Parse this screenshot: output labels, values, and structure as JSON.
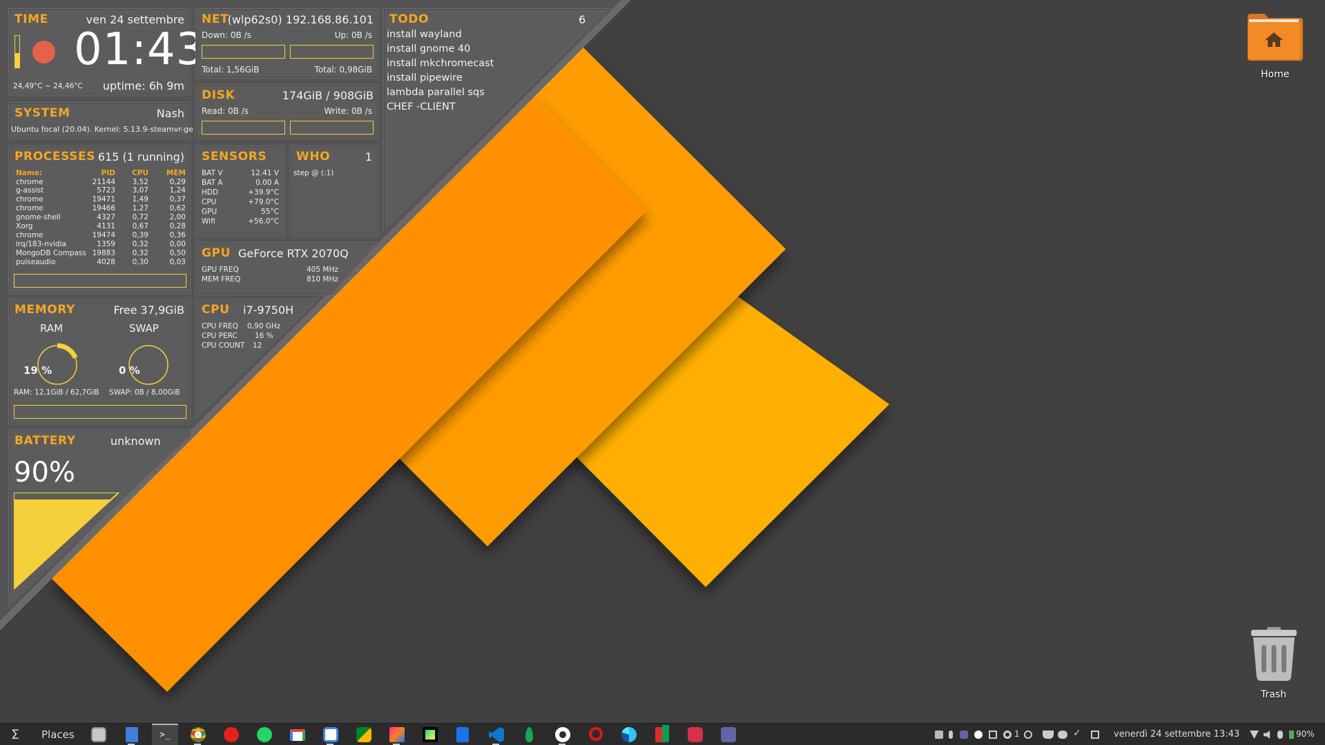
{
  "colors": {
    "accent": "#f5a623",
    "bar_border": "#f5d03a",
    "panel_bg": "#5c5c5c",
    "desktop_bg": "#414141"
  },
  "time": {
    "title": "TIME",
    "date": "ven 24 settembre",
    "clock": "01:43",
    "temp": "24,49°C ~ 24,46°C",
    "uptime": "uptime: 6h 9m"
  },
  "system": {
    "title": "SYSTEM",
    "host": "Nash",
    "info": "Ubuntu focal (20.04). Kernel: 5.13.9-steamvr-ge"
  },
  "processes": {
    "title": "PROCESSES",
    "count": "615 (1 running)",
    "columns": [
      "Name:",
      "PID",
      "CPU",
      "MEM"
    ],
    "rows": [
      [
        "chrome",
        "21144",
        "3,52",
        "0,29"
      ],
      [
        "g-assist",
        "5723",
        "3,07",
        "1,24"
      ],
      [
        "chrome",
        "19471",
        "1,49",
        "0,37"
      ],
      [
        "chrome",
        "19466",
        "1,27",
        "0,62"
      ],
      [
        "gnome-shell",
        "4327",
        "0,72",
        "2,00"
      ],
      [
        "Xorg",
        "4131",
        "0,67",
        "0,28"
      ],
      [
        "chrome",
        "19474",
        "0,39",
        "0,36"
      ],
      [
        "irq/183-nvidia",
        "1359",
        "0,32",
        "0,00"
      ],
      [
        "MongoDB Compass",
        "19883",
        "0,32",
        "0,50"
      ],
      [
        "pulseaudio",
        "4028",
        "0,30",
        "0,03"
      ]
    ]
  },
  "memory": {
    "title": "MEMORY",
    "free": "Free 37,9GiB",
    "ram_label": "RAM",
    "swap_label": "SWAP",
    "ram_pct_text": "19 %",
    "swap_pct_text": "0 %",
    "ram_fraction": 0.19,
    "swap_fraction": 0.0,
    "ram_detail": "RAM: 12,1GiB / 62,7GiB",
    "swap_detail": "SWAP: 0B   / 8,00GiB"
  },
  "battery": {
    "title": "BATTERY",
    "status": "unknown",
    "percent_text": "90%",
    "fraction": 0.9
  },
  "net": {
    "title": "NET",
    "iface": "(wlp62s0) 192.168.86.101",
    "down": "Down: 0B  /s",
    "up": "Up: 0B  /s",
    "total_down": "Total: 1,56GiB",
    "total_up": "Total: 0,98GiB"
  },
  "disk": {
    "title": "DISK",
    "usage": "174GiB / 908GiB",
    "read": "Read: 0B  /s",
    "write": "Write: 0B  /s"
  },
  "sensors": {
    "title": "SENSORS",
    "rows": [
      [
        "BAT V",
        "12.41 V"
      ],
      [
        "BAT A",
        "0.00 A"
      ],
      [
        "HDD",
        "+39.9°C"
      ],
      [
        "CPU",
        "+79.0°C"
      ],
      [
        "GPU",
        "55°C"
      ],
      [
        "Wifi",
        "+56.0°C"
      ]
    ]
  },
  "who": {
    "title": "WHO",
    "count": "1",
    "entry": "step @ (:1)"
  },
  "gpu": {
    "title": "GPU",
    "model": "GeForce RTX 2070Q",
    "rows": [
      [
        "GPU  FREQ",
        "405 MHz"
      ],
      [
        "MEM FREQ",
        "810 MHz"
      ]
    ]
  },
  "cpu": {
    "title": "CPU",
    "model": "i7-9750H",
    "rows": [
      [
        "CPU FREQ",
        "0,90 GHz"
      ],
      [
        "CPU PERC",
        "16 %"
      ],
      [
        "CPU COUNT",
        "12"
      ]
    ]
  },
  "todo": {
    "title": "TODO",
    "count": "6",
    "items": [
      "install wayland",
      "install gnome 40",
      "install mkchromecast",
      "install pipewire",
      "lambda parallel sqs",
      "CHEF -CLIENT"
    ]
  },
  "desktop": {
    "home_label": "Home",
    "trash_label": "Trash"
  },
  "taskbar": {
    "places": "Places",
    "clock": "venerdì 24 settembre 13:43",
    "workspace_count": "1",
    "battery": "90%",
    "apps": [
      "files-icon",
      "text-editor-icon",
      "terminal-icon",
      "chrome-icon",
      "youtube-music-icon",
      "whatsapp-icon",
      "gmail-icon",
      "calendar-icon",
      "meet-icon",
      "jetbrains-icon",
      "pycharm-icon",
      "mongodb-compass-icon",
      "vscode-icon",
      "mongodb-icon",
      "github-icon",
      "opera-icon",
      "edge-icon",
      "robinhood-icon",
      "speaker-deck-icon",
      "teams-icon"
    ]
  }
}
